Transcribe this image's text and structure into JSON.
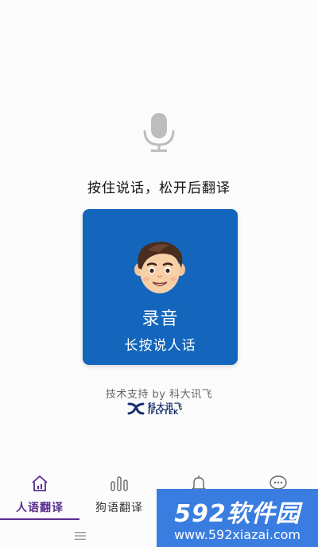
{
  "prompt": {
    "instruction": "按住说话，松开后翻译"
  },
  "record_card": {
    "title": "录音",
    "subtitle": "长按说人话"
  },
  "footer": {
    "support_text": "技术支持 by 科大讯飞",
    "brand_cn": "科大讯飞",
    "brand_en": "IFLYTEK"
  },
  "tabs": [
    {
      "label": "人语翻译",
      "icon": "home-icon",
      "active": true
    },
    {
      "label": "狗语翻译",
      "icon": "bars-icon",
      "active": false
    },
    {
      "label": "",
      "icon": "bell-icon",
      "active": false
    },
    {
      "label": "",
      "icon": "chat-icon",
      "active": false
    }
  ],
  "watermark": {
    "brand": "592软件园",
    "url": "www.592xiazai.com"
  },
  "colors": {
    "card_blue": "#1466bd",
    "accent_purple": "#5a2d91",
    "watermark_blue": "#3a7de0"
  }
}
